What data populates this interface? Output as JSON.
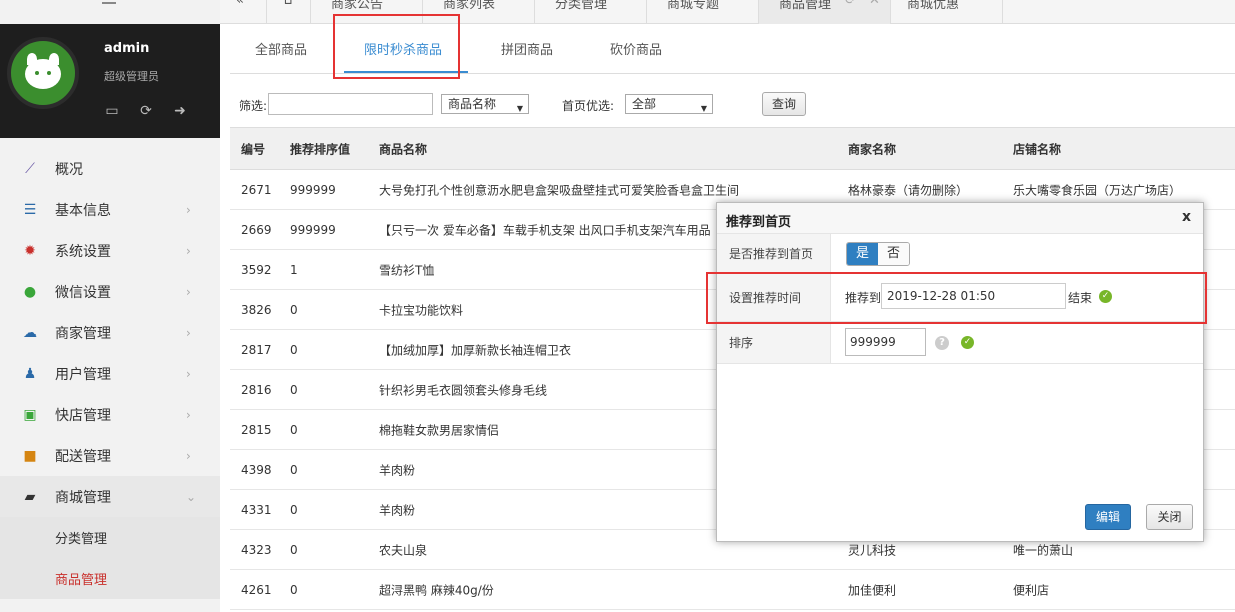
{
  "topbar": {
    "tabs": [
      "商家公告",
      "商家列表",
      "分类管理",
      "商城专题",
      "商品管理",
      "商城优惠"
    ]
  },
  "profile": {
    "name": "admin",
    "role": "超级管理员"
  },
  "sidebar": {
    "items": [
      {
        "label": "概况",
        "icon": "chart-line-icon",
        "color": "#6b5aa6"
      },
      {
        "label": "基本信息",
        "icon": "list-icon",
        "color": "#2b6aa8"
      },
      {
        "label": "系统设置",
        "icon": "gear-icon",
        "color": "#c9302c"
      },
      {
        "label": "微信设置",
        "icon": "wechat-icon",
        "color": "#3aa63a"
      },
      {
        "label": "商家管理",
        "icon": "cloud-icon",
        "color": "#2b6aa8"
      },
      {
        "label": "用户管理",
        "icon": "user-icon",
        "color": "#2b6aa8"
      },
      {
        "label": "快店管理",
        "icon": "basket-icon",
        "color": "#3aa63a"
      },
      {
        "label": "配送管理",
        "icon": "truck-icon",
        "color": "#d58512"
      },
      {
        "label": "商城管理",
        "icon": "shopping-bag-icon",
        "color": "#333333"
      }
    ],
    "sub_items": [
      "分类管理",
      "商品管理"
    ]
  },
  "subtabs": [
    "全部商品",
    "限时秒杀商品",
    "拼团商品",
    "砍价商品"
  ],
  "filter": {
    "label": "筛选:",
    "field_select": "商品名称",
    "home_label": "首页优选:",
    "home_select": "全部",
    "query_button": "查询"
  },
  "table": {
    "headers": [
      "编号",
      "推荐排序值",
      "商品名称",
      "商家名称",
      "店铺名称"
    ],
    "rows": [
      [
        "2671",
        "999999",
        "大号免打孔个性创意沥水肥皂盒架吸盘壁挂式可爱笑脸香皂盒卫生间",
        "格林豪泰（请勿删除）",
        "乐大嘴零食乐园（万达广场店）"
      ],
      [
        "2669",
        "999999",
        "【只亏一次 爱车必备】车载手机支架 出风口手机支架汽车用品",
        "",
        ""
      ],
      [
        "3592",
        "1",
        "雪纺衫T恤",
        "",
        ""
      ],
      [
        "3826",
        "0",
        "卡拉宝功能饮料",
        "",
        ""
      ],
      [
        "2817",
        "0",
        "【加绒加厚】加厚新款长袖连帽卫衣",
        "",
        ""
      ],
      [
        "2816",
        "0",
        "针织衫男毛衣圆领套头修身毛线",
        "",
        ""
      ],
      [
        "2815",
        "0",
        "棉拖鞋女款男居家情侣",
        "",
        ""
      ],
      [
        "4398",
        "0",
        "羊肉粉",
        "",
        ""
      ],
      [
        "4331",
        "0",
        "羊肉粉",
        "",
        ""
      ],
      [
        "4323",
        "0",
        "农夫山泉",
        "灵儿科技",
        "唯一的萧山"
      ],
      [
        "4261",
        "0",
        "超浔黑鸭 麻辣40g/份",
        "加佳便利",
        "便利店"
      ]
    ]
  },
  "modal": {
    "title": "推荐到首页",
    "close": "x",
    "row1_label": "是否推荐到首页",
    "yes": "是",
    "no": "否",
    "row2_label": "设置推荐时间",
    "prefix": "推荐到",
    "datetime": "2019-12-28 01:50",
    "suffix": "结束",
    "row3_label": "排序",
    "sort_value": "999999",
    "edit_button": "编辑",
    "close_button": "关闭"
  }
}
